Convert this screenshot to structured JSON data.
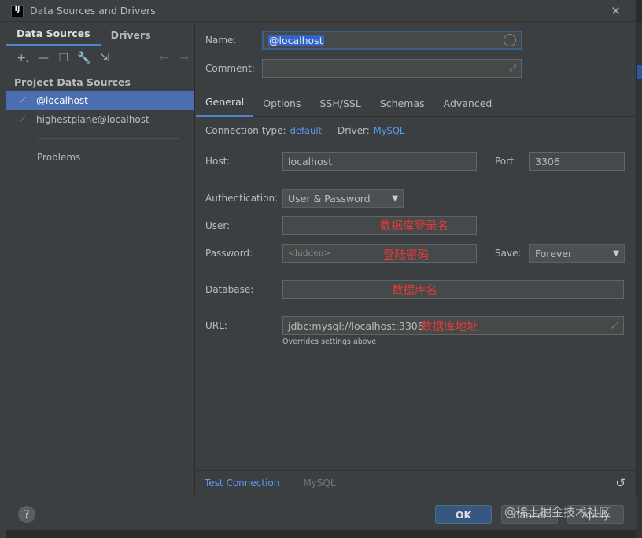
{
  "window": {
    "title": "Data Sources and Drivers",
    "app_icon_text": "IJ"
  },
  "left": {
    "tabs": [
      {
        "label": "Data Sources"
      },
      {
        "label": "Drivers"
      }
    ],
    "section_title": "Project Data Sources",
    "items": [
      {
        "label": "@localhost"
      },
      {
        "label": "highestplane@localhost"
      }
    ],
    "problems_label": "Problems"
  },
  "form": {
    "name_label": "Name:",
    "name_value": "@localhost",
    "comment_label": "Comment:",
    "tabs": [
      {
        "label": "General"
      },
      {
        "label": "Options"
      },
      {
        "label": "SSH/SSL"
      },
      {
        "label": "Schemas"
      },
      {
        "label": "Advanced"
      }
    ],
    "connection_type_label": "Connection type:",
    "connection_type_value": "default",
    "driver_label": "Driver:",
    "driver_value": "MySQL",
    "host_label": "Host:",
    "host_value": "localhost",
    "port_label": "Port:",
    "port_value": "3306",
    "auth_label": "Authentication:",
    "auth_value": "User & Password",
    "user_label": "User:",
    "password_label": "Password:",
    "password_placeholder": "<hidden>",
    "save_label": "Save:",
    "save_value": "Forever",
    "database_label": "Database:",
    "url_label": "URL:",
    "url_value": "jdbc:mysql://localhost:3306",
    "url_hint": "Overrides settings above"
  },
  "annotations": {
    "user": "数据库登录名",
    "password": "登陆密码",
    "database": "数据库名",
    "url": "数据库地址"
  },
  "footer": {
    "test_connection": "Test Connection",
    "driver_name": "MySQL"
  },
  "buttons": {
    "ok": "OK",
    "cancel": "Cancel",
    "apply": "Apply",
    "help": "?"
  },
  "watermark": "@稀土掘金技术社区"
}
